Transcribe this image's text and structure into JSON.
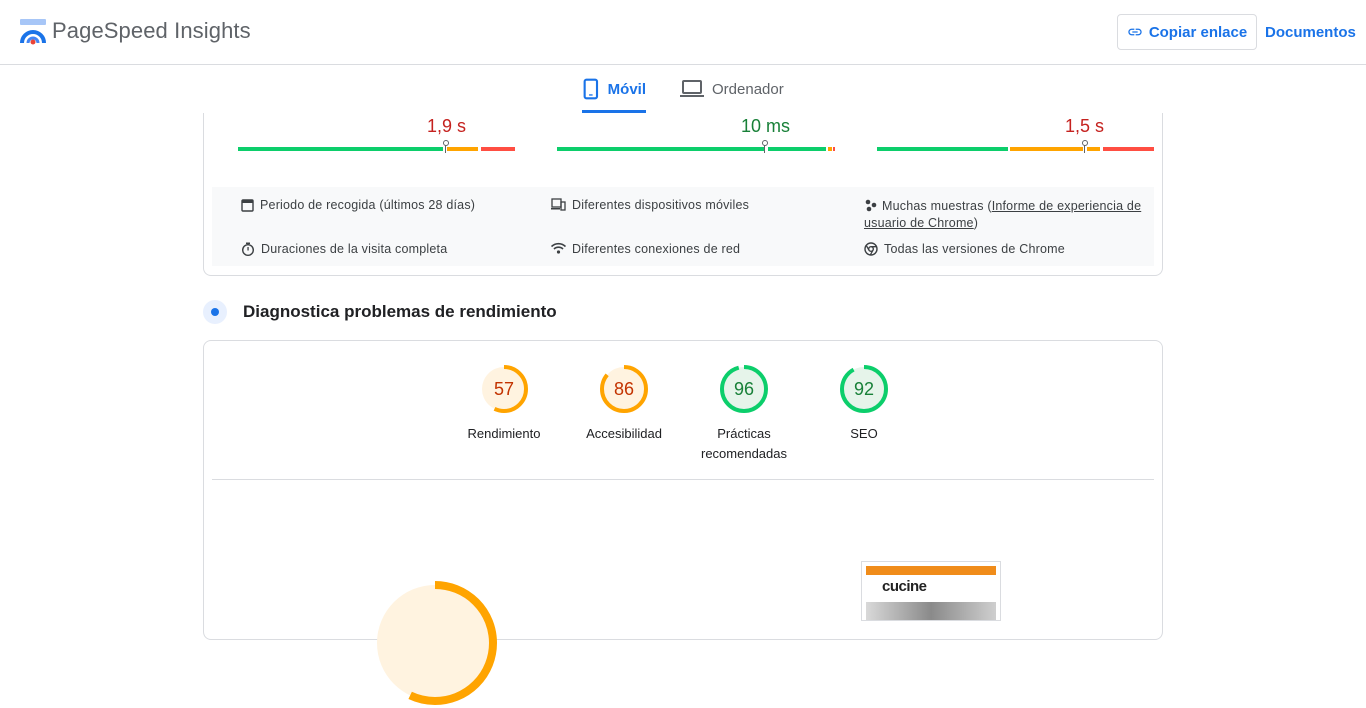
{
  "header": {
    "app_title": "PageSpeed Insights",
    "copy_link_label": "Copiar enlace",
    "docs_label": "Documentos"
  },
  "tabs": [
    {
      "label": "Móvil",
      "active": true,
      "icon": "smartphone-icon"
    },
    {
      "label": "Ordenador",
      "active": false,
      "icon": "laptop-icon"
    }
  ],
  "field_metrics": [
    {
      "value": "1,9 s",
      "color": "#c5221f"
    },
    {
      "value": "10 ms",
      "color": "#188038"
    },
    {
      "value": "1,5 s",
      "color": "#c5221f"
    }
  ],
  "info": {
    "collection_period": "Periodo de recogida (últimos 28 días)",
    "devices": "Diferentes dispositivos móviles",
    "samples_prefix": "Muchas muestras (",
    "samples_link": "Informe de experiencia de usuario de Chrome",
    "samples_suffix": ")",
    "durations": "Duraciones de la visita completa",
    "connections": "Diferentes conexiones de red",
    "chrome_versions": "Todas las versiones de Chrome"
  },
  "diagnostics": {
    "title": "Diagnostica problemas de rendimiento"
  },
  "scores": [
    {
      "value": "57",
      "label": "Rendimiento",
      "fraction": 0.57,
      "color": "#e8710a",
      "bg": "#fff3e0"
    },
    {
      "value": "86",
      "label": "Accesibilidad",
      "fraction": 0.86,
      "color": "#e8710a",
      "bg": "#fff3e0"
    },
    {
      "value": "96",
      "label": "Prácticas recomendadas",
      "fraction": 0.96,
      "color": "#0cce6b",
      "bg": "#e6f4ea"
    },
    {
      "value": "92",
      "label": "SEO",
      "fraction": 0.92,
      "color": "#0cce6b",
      "bg": "#e6f4ea"
    }
  ],
  "thumbnail": {
    "brand": "cucine"
  },
  "colors": {
    "accent": "#1a73e8",
    "good": "#0cce6b",
    "average": "#ffa400",
    "poor": "#ff4e42"
  }
}
